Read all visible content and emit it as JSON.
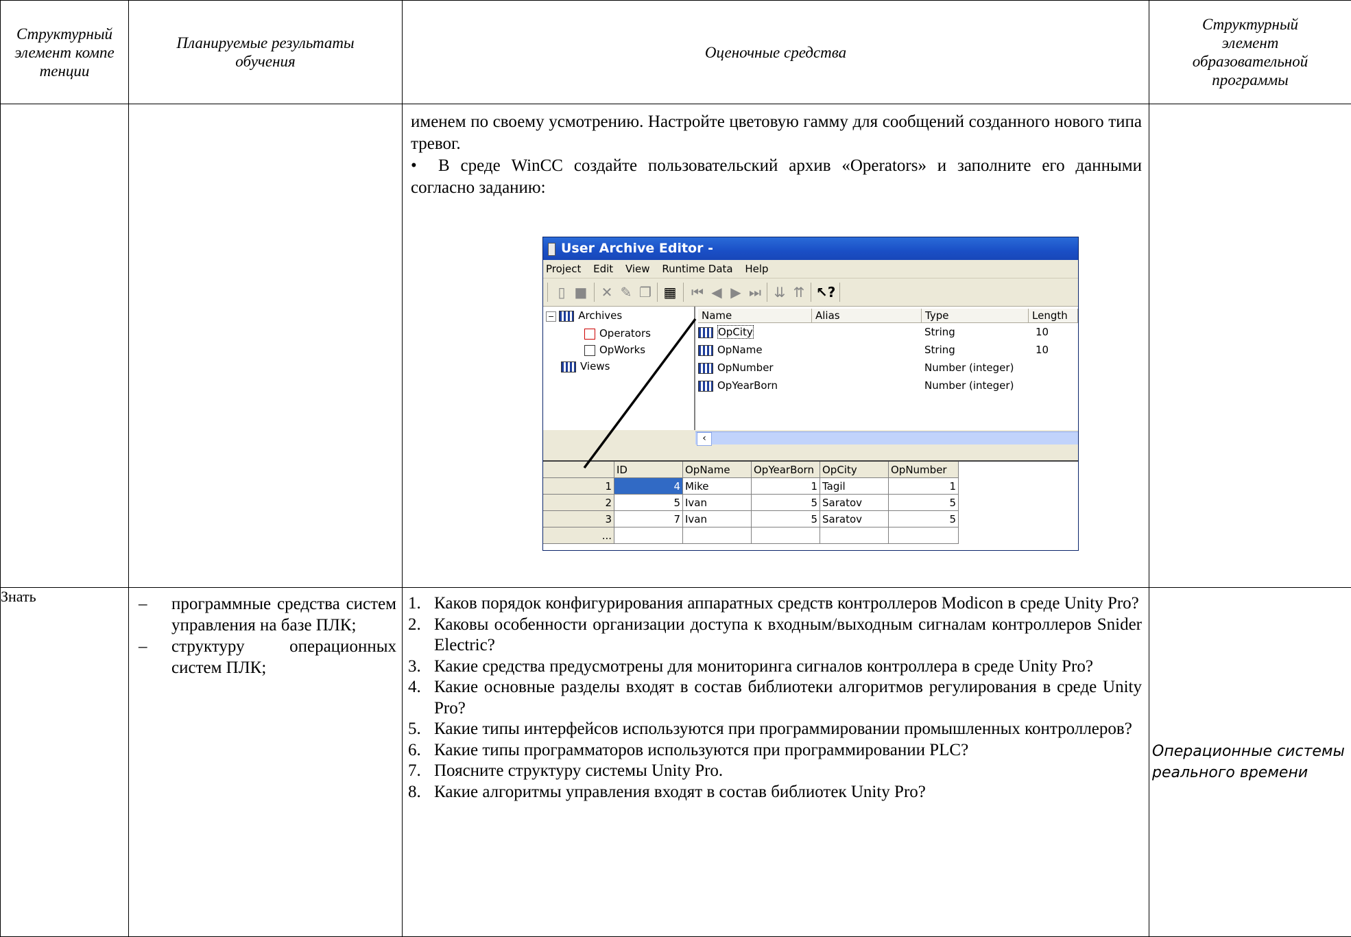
{
  "header": {
    "col1": "Структурный элемент компетенции",
    "col2": "Планируемые результаты обучения",
    "col3": "Оценочные средства",
    "col4": "Структурный элемент образовательной программы"
  },
  "row1": {
    "para1": "именем по своему усмотрению. Настройте цветовую гамму для сообщений созданного нового типа тревог.",
    "bullet": "•",
    "para2": "В среде WinCC создайте пользовательский архив «Operators» и заполните его данными согласно заданию:",
    "screenshot": {
      "title": "User Archive Editor -",
      "menu": [
        "Project",
        "Edit",
        "View",
        "Runtime Data",
        "Help"
      ],
      "tree": {
        "root": "Archives",
        "items": [
          "Operators",
          "OpWorks"
        ],
        "views": "Views"
      },
      "fields_columns": [
        "Name",
        "Alias",
        "Type",
        "Length"
      ],
      "fields": [
        {
          "name": "OpCity",
          "type": "String",
          "length": "10"
        },
        {
          "name": "OpName",
          "type": "String",
          "length": "10"
        },
        {
          "name": "OpNumber",
          "type": "Number (integer)",
          "length": ""
        },
        {
          "name": "OpYearBorn",
          "type": "Number (integer)",
          "length": ""
        }
      ],
      "data_columns": [
        "ID",
        "OpName",
        "OpYearBorn",
        "OpCity",
        "OpNumber"
      ],
      "data_rows": [
        {
          "row": "1",
          "id": "4",
          "opname": "Mike",
          "year": "1",
          "city": "Tagil",
          "number": "1"
        },
        {
          "row": "2",
          "id": "5",
          "opname": "Ivan",
          "year": "5",
          "city": "Saratov",
          "number": "5"
        },
        {
          "row": "3",
          "id": "7",
          "opname": "Ivan",
          "year": "5",
          "city": "Saratov",
          "number": "5"
        }
      ],
      "new_row": "..."
    }
  },
  "row2": {
    "element": "Знать",
    "outcomes": [
      "программные средства систем управления на базе ПЛК;",
      "структуру операционных систем ПЛК;"
    ],
    "questions": [
      "Каков порядок конфигурирования аппаратных средств контроллеров Modicon в среде Unity Pro?",
      "Каковы особенности организации доступа к входным/выходным сигналам контроллеров Snider Electric?",
      "Какие средства предусмотрены для мониторинга сигналов контроллера в среде Unity Pro?",
      "Какие основные разделы входят в состав библиотеки алгоритмов регулирования в среде Unity Pro?",
      "Какие типы интерфейсов используются при программировании промышленных контроллеров?",
      "Какие типы программаторов используются при программировании PLC?",
      "Поясните структуру системы Unity Pro.",
      "Какие алгоритмы управления входят в состав библиотек Unity Pro?"
    ],
    "program_element": "Операционные системы реального времени"
  }
}
